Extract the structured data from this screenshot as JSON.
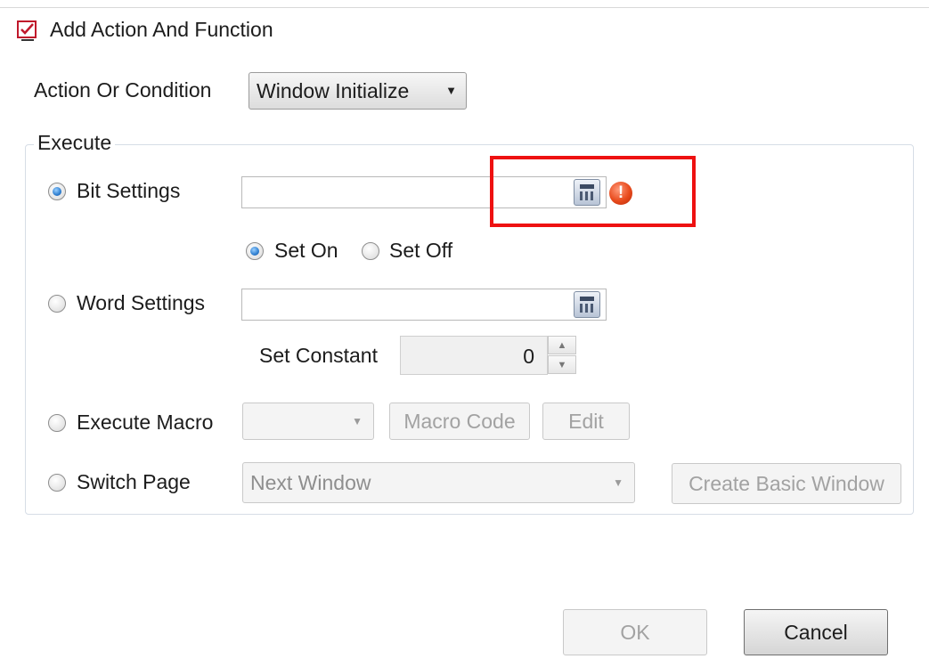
{
  "window": {
    "title": "Add Action And Function",
    "close_glyph": "✕"
  },
  "action": {
    "label": "Action Or Condition",
    "selected": "Window Initialize"
  },
  "execute": {
    "legend": "Execute",
    "bit_settings": {
      "label": "Bit Settings",
      "value": "",
      "selected": true
    },
    "set_on": {
      "label": "Set On",
      "selected": true
    },
    "set_off": {
      "label": "Set Off",
      "selected": false
    },
    "word_settings": {
      "label": "Word Settings",
      "value": "",
      "selected": false
    },
    "set_constant": {
      "label": "Set Constant",
      "value": "0"
    },
    "execute_macro": {
      "label": "Execute Macro",
      "selected_macro": "",
      "selected": false,
      "macro_code_label": "Macro Code",
      "edit_label": "Edit"
    },
    "switch_page": {
      "label": "Switch Page",
      "selected": false,
      "page": "Next Window",
      "create_label": "Create Basic Window"
    }
  },
  "footer": {
    "ok_label": "OK",
    "cancel_label": "Cancel"
  },
  "icons": {
    "app": "checklist-icon",
    "address_picker": "calculator-icon",
    "warning": "warning-icon",
    "warning_glyph": "!",
    "dropdown_glyph": "▼",
    "spin_up_glyph": "▲",
    "spin_down_glyph": "▼"
  },
  "colors": {
    "highlight": "#ee1111",
    "warning": "#e84a1c",
    "radio_checked": "#2f7fd0"
  }
}
